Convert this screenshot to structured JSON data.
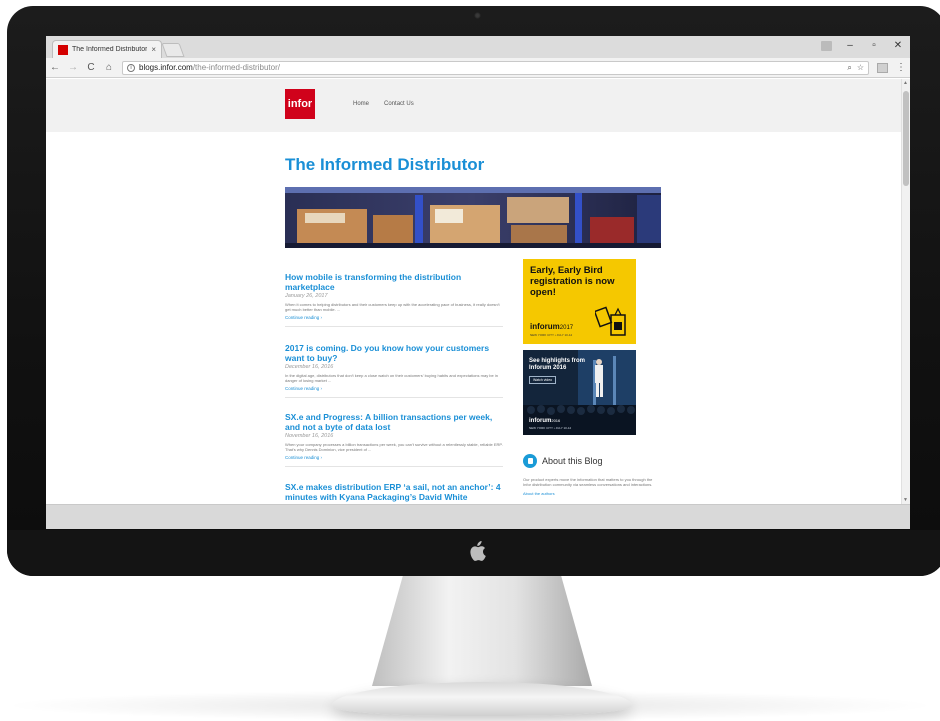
{
  "browser": {
    "tab_title": "The Informed Distributor",
    "tab_close": "×",
    "url_host": "blogs.infor.com",
    "url_path": "/the-informed-distributor/",
    "win_minimize": "–",
    "win_maximize": "▫",
    "win_close": "✕",
    "back": "←",
    "forward": "→",
    "reload": "C",
    "home": "⌂",
    "zoom_icon": "⌕",
    "star_icon": "☆",
    "menu": "⋮"
  },
  "site": {
    "logo_text": "infor",
    "nav": [
      {
        "label": "Home"
      },
      {
        "label": "Contact Us"
      }
    ],
    "blog_title": "The Informed Distributor"
  },
  "posts": [
    {
      "title": "How mobile is transforming the distribution marketplace",
      "date": "January 26, 2017",
      "excerpt": "When it comes to helping distributors and their customers keep up with the accelerating pace of business, it really doesn't get much better than mobile. ...",
      "more": "Continue reading ›"
    },
    {
      "title": "2017 is coming. Do you know how your customers want to buy?",
      "date": "December 16, 2016",
      "excerpt": "In the digital age, distributors that don't keep a close watch on their customers' buying habits and expectations may be in danger of losing market ...",
      "more": "Continue reading ›"
    },
    {
      "title": "SX.e and Progress: A billion transactions per week, and not a byte of data lost",
      "date": "November 16, 2016",
      "excerpt": "When your company processes a billion transactions per week, you can't survive without a relentlessly stable, reliable ERP. That's why Dennis Dominion, vice president of ...",
      "more": "Continue reading ›"
    },
    {
      "title": "SX.e makes distribution ERP ‘a sail, not an anchor’: 4 minutes with Kyana Packaging’s David White",
      "date": "",
      "excerpt": "",
      "more": ""
    }
  ],
  "sidebar": {
    "ad1": {
      "headline": "Early, Early Bird registration is now open!",
      "brand": "inforum",
      "brand_year": "2017",
      "sub": "NEW YORK CITY • JULY 10-12"
    },
    "ad2": {
      "headline": "See highlights from Inforum 2016",
      "button": "Watch video",
      "brand": "inforum",
      "brand_year": "2016",
      "sub": "NEW YORK CITY • JULY 10-12"
    },
    "about": {
      "title": "About this Blog",
      "text": "Our product experts move the information that matters to you through the Infor distribution community via seamless conversations and interactions.",
      "link": "About the authors"
    }
  },
  "colors": {
    "brand_red": "#d0021b",
    "link_blue": "#1a8fd6",
    "ad_yellow": "#f5c800",
    "ad_navy": "#13253b"
  }
}
